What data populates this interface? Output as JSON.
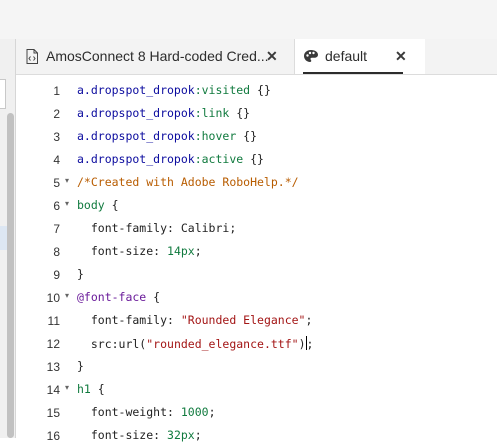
{
  "tabs": [
    {
      "title": "AmosConnect 8 Hard-coded Cred...",
      "icon": "code-file-icon",
      "close": "✕"
    },
    {
      "title": "default",
      "icon": "palette-icon",
      "close": "✕",
      "active": true
    }
  ],
  "editor": {
    "lines": [
      {
        "num": "1",
        "fold": "",
        "tokens": [
          {
            "t": "a.dropspot_dropok",
            "c": "selector"
          },
          {
            "t": ":visited",
            "c": "keyword"
          },
          {
            "t": " {}",
            "c": "plain"
          }
        ]
      },
      {
        "num": "2",
        "fold": "",
        "tokens": [
          {
            "t": "a.dropspot_dropok",
            "c": "selector"
          },
          {
            "t": ":link",
            "c": "keyword"
          },
          {
            "t": " {}",
            "c": "plain"
          }
        ]
      },
      {
        "num": "3",
        "fold": "",
        "tokens": [
          {
            "t": "a.dropspot_dropok",
            "c": "selector"
          },
          {
            "t": ":hover",
            "c": "keyword"
          },
          {
            "t": " {}",
            "c": "plain"
          }
        ]
      },
      {
        "num": "4",
        "fold": "",
        "tokens": [
          {
            "t": "a.dropspot_dropok",
            "c": "selector"
          },
          {
            "t": ":active",
            "c": "keyword"
          },
          {
            "t": " {}",
            "c": "plain"
          }
        ]
      },
      {
        "num": "5",
        "fold": "▾",
        "tokens": [
          {
            "t": "/*Created with Adobe RoboHelp.*/",
            "c": "comment"
          }
        ]
      },
      {
        "num": "6",
        "fold": "▾",
        "tokens": [
          {
            "t": "body",
            "c": "keyword"
          },
          {
            "t": " {",
            "c": "plain"
          }
        ]
      },
      {
        "num": "7",
        "fold": "",
        "tokens": [
          {
            "t": "  font-family: Calibri;",
            "c": "plain"
          }
        ]
      },
      {
        "num": "8",
        "fold": "",
        "tokens": [
          {
            "t": "  font-size: ",
            "c": "plain"
          },
          {
            "t": "14px",
            "c": "number"
          },
          {
            "t": ";",
            "c": "plain"
          }
        ]
      },
      {
        "num": "9",
        "fold": "",
        "tokens": [
          {
            "t": "}",
            "c": "plain"
          }
        ]
      },
      {
        "num": "10",
        "fold": "▾",
        "tokens": [
          {
            "t": "@font-face",
            "c": "at"
          },
          {
            "t": " {",
            "c": "plain"
          }
        ]
      },
      {
        "num": "11",
        "fold": "",
        "tokens": [
          {
            "t": "  font-family: ",
            "c": "plain"
          },
          {
            "t": "\"Rounded Elegance\"",
            "c": "string"
          },
          {
            "t": ";",
            "c": "plain"
          }
        ]
      },
      {
        "num": "12",
        "fold": "",
        "tokens": [
          {
            "t": "  src:url(",
            "c": "plain"
          },
          {
            "t": "\"rounded_elegance.ttf\"",
            "c": "string"
          },
          {
            "t": ")",
            "c": "plain"
          },
          {
            "t": "|",
            "c": "cursor"
          },
          {
            "t": ";",
            "c": "plain"
          }
        ]
      },
      {
        "num": "13",
        "fold": "",
        "tokens": [
          {
            "t": "}",
            "c": "plain"
          }
        ]
      },
      {
        "num": "14",
        "fold": "▾",
        "tokens": [
          {
            "t": "h1",
            "c": "keyword"
          },
          {
            "t": " {",
            "c": "plain"
          }
        ]
      },
      {
        "num": "15",
        "fold": "",
        "tokens": [
          {
            "t": "  font-weight: ",
            "c": "plain"
          },
          {
            "t": "1000",
            "c": "number"
          },
          {
            "t": ";",
            "c": "plain"
          }
        ]
      },
      {
        "num": "16",
        "fold": "",
        "tokens": [
          {
            "t": "  font-size: ",
            "c": "plain"
          },
          {
            "t": "32px",
            "c": "number"
          },
          {
            "t": ";",
            "c": "plain"
          }
        ]
      }
    ]
  }
}
